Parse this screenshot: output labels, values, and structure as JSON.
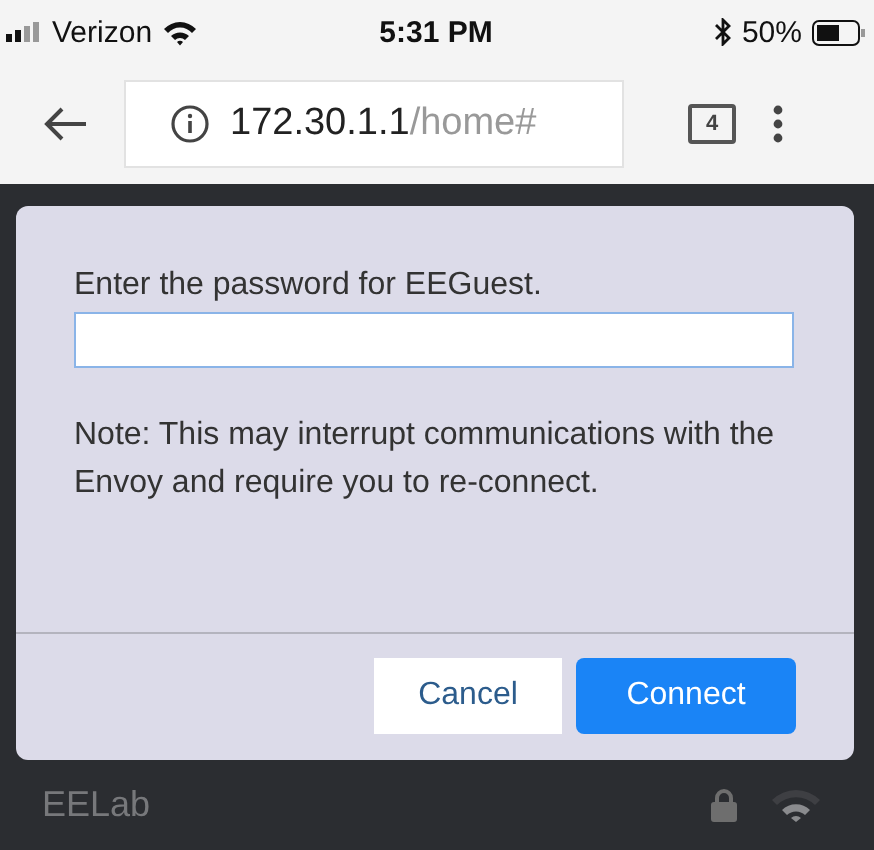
{
  "status_bar": {
    "carrier": "Verizon",
    "time": "5:31 PM",
    "battery": "50%"
  },
  "browser": {
    "url_host": "172.30.1.1",
    "url_path": "/home#",
    "tab_count": "4"
  },
  "dialog": {
    "prompt": "Enter the password for EEGuest.",
    "note": "Note: This may interrupt communications with the Envoy and require you to re-connect.",
    "buttons": [
      {
        "label": "Cancel",
        "kind": "secondary"
      },
      {
        "label": "Connect",
        "kind": "primary"
      }
    ]
  },
  "networks": [
    {
      "name": "EELab",
      "locked": true
    }
  ]
}
